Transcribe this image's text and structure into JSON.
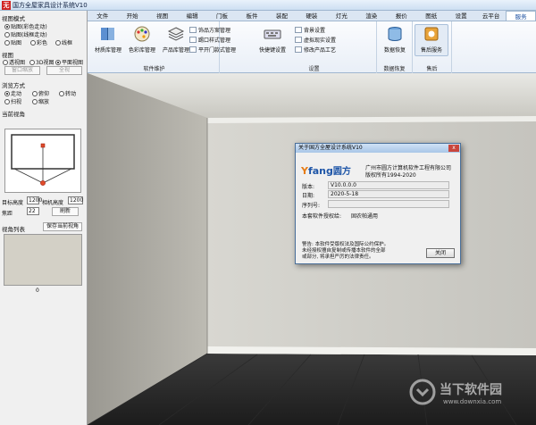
{
  "window": {
    "title": "国方全屋家具设计系统V10",
    "app_icon": "无"
  },
  "menu": [
    "文件",
    "开始",
    "视图",
    "编辑",
    "门板",
    "板件",
    "装配",
    "硬装",
    "灯光",
    "渲染",
    "报价",
    "图纸",
    "设置",
    "云平台",
    "服务"
  ],
  "menu_active_index": 14,
  "ribbon": {
    "group1_label": "软件维护",
    "group1_buttons": [
      "材质库管理",
      "色彩库管理",
      "产品库管理"
    ],
    "group1_small": [
      "饰品方案管理",
      "踢口样式管理",
      "平开门款式管理"
    ],
    "group2_label": "设置",
    "group2_buttons": [
      "快捷键设置"
    ],
    "group2_small": [
      "背景设置",
      "虚拟现实设置",
      "修改产品工艺"
    ],
    "group3_label": "数据恢复",
    "group3_buttons": [
      "数据恢复"
    ],
    "group4_label": "售后",
    "group4_buttons": [
      "售后服务"
    ]
  },
  "left_panel": {
    "view_mode_title": "视图模式",
    "view_modes": [
      "贴图(彩色走动)",
      "贴图(线框走动)",
      "贴图",
      "彩色",
      "线框"
    ],
    "view_title": "视图",
    "views": [
      "透视图",
      "3D视图",
      "平面视图"
    ],
    "view_btn_1": "窗口缩放",
    "view_btn_2": "全视",
    "browse_title": "浏览方式",
    "browse_modes": [
      "走动",
      "俯仰",
      "转动",
      "扫视",
      "缩放"
    ],
    "current_view_title": "当前视角",
    "target_height_label": "目标高度",
    "target_height_value": "1200",
    "camera_height_label": "相机高度",
    "camera_height_value": "1200",
    "focal_label": "焦距",
    "focal_value": "22",
    "refresh": "刷新",
    "view_list_title": "视角列表",
    "save_view": "保存当前视角",
    "thumb_index": "0"
  },
  "dialog": {
    "title": "关于国方全屋设计系统V10",
    "close_x": "x",
    "logo_y": "Y",
    "logo_fang": "fang",
    "logo_cn": "圆方",
    "company": "广州市圆方计算机软件工程有限公司",
    "copyright": "版权所有1994-2020",
    "version_label": "版本:",
    "version": "V10.0.0.0",
    "date_label": "日期:",
    "date": "2020-5-18",
    "serial_label": "序列号:",
    "license_label": "本套软件授权给:",
    "license_to": "固农帕通用",
    "warning_1": "警告: 本软件受版权法及国际公约保护。",
    "warning_2": "未经授权擅自复制或传播本软件的全部",
    "warning_3": "或部分, 将承担严厉的法律责任。",
    "close_btn": "关闭"
  },
  "watermark": {
    "text": "当下软件园",
    "url": "www.downxia.com"
  }
}
